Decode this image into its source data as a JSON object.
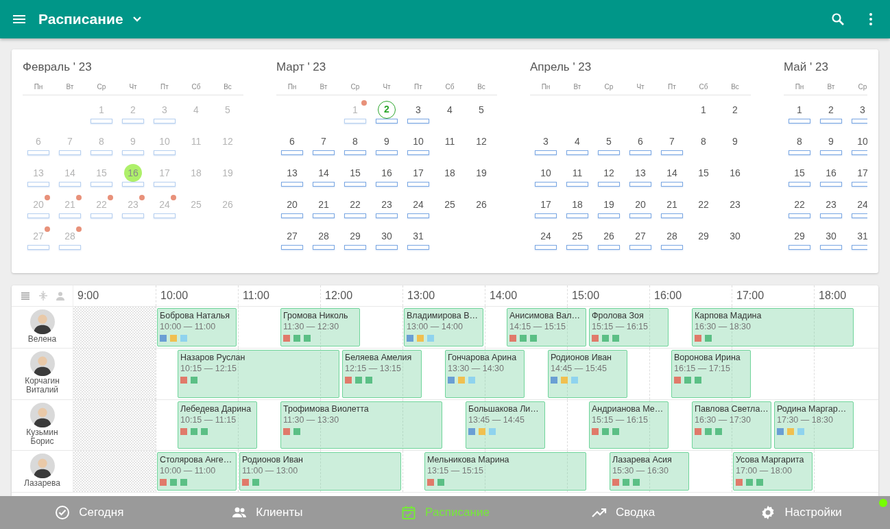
{
  "app_bar": {
    "title": "Расписание"
  },
  "calendar": {
    "months": [
      {
        "title": "Февраль ' 23",
        "weekdays": [
          "Пн",
          "Вт",
          "Ср",
          "Чт",
          "Пт",
          "Сб",
          "Вс"
        ],
        "weeks": [
          [
            {
              "kind": "empty"
            },
            {
              "kind": "empty"
            },
            {
              "kind": "day",
              "d": "1",
              "past": true,
              "bar": true,
              "dot": false,
              "selected": false,
              "today": false
            },
            {
              "kind": "day",
              "d": "2",
              "past": true,
              "bar": true,
              "dot": false,
              "selected": false,
              "today": false
            },
            {
              "kind": "day",
              "d": "3",
              "past": true,
              "bar": true,
              "dot": false,
              "selected": false,
              "today": false
            },
            {
              "kind": "day",
              "d": "4",
              "past": true,
              "bar": false,
              "dot": false,
              "selected": false,
              "today": false
            },
            {
              "kind": "day",
              "d": "5",
              "past": true,
              "bar": false,
              "dot": false,
              "selected": false,
              "today": false
            }
          ],
          [
            {
              "kind": "day",
              "d": "6",
              "past": true,
              "bar": true,
              "dot": false,
              "selected": false,
              "today": false
            },
            {
              "kind": "day",
              "d": "7",
              "past": true,
              "bar": true,
              "dot": false,
              "selected": false,
              "today": false
            },
            {
              "kind": "day",
              "d": "8",
              "past": true,
              "bar": true,
              "dot": false,
              "selected": false,
              "today": false
            },
            {
              "kind": "day",
              "d": "9",
              "past": true,
              "bar": true,
              "dot": false,
              "selected": false,
              "today": false
            },
            {
              "kind": "day",
              "d": "10",
              "past": true,
              "bar": true,
              "dot": false,
              "selected": false,
              "today": false
            },
            {
              "kind": "day",
              "d": "11",
              "past": true,
              "bar": false,
              "dot": false,
              "selected": false,
              "today": false
            },
            {
              "kind": "day",
              "d": "12",
              "past": true,
              "bar": false,
              "dot": false,
              "selected": false,
              "today": false
            }
          ],
          [
            {
              "kind": "day",
              "d": "13",
              "past": true,
              "bar": true,
              "dot": false,
              "selected": false,
              "today": false
            },
            {
              "kind": "day",
              "d": "14",
              "past": true,
              "bar": true,
              "dot": false,
              "selected": false,
              "today": false
            },
            {
              "kind": "day",
              "d": "15",
              "past": true,
              "bar": true,
              "dot": false,
              "selected": false,
              "today": false
            },
            {
              "kind": "day",
              "d": "16",
              "past": true,
              "bar": true,
              "dot": false,
              "selected": true,
              "today": false
            },
            {
              "kind": "day",
              "d": "17",
              "past": true,
              "bar": true,
              "dot": false,
              "selected": false,
              "today": false
            },
            {
              "kind": "day",
              "d": "18",
              "past": true,
              "bar": false,
              "dot": false,
              "selected": false,
              "today": false
            },
            {
              "kind": "day",
              "d": "19",
              "past": true,
              "bar": false,
              "dot": false,
              "selected": false,
              "today": false
            }
          ],
          [
            {
              "kind": "day",
              "d": "20",
              "past": true,
              "bar": true,
              "dot": true,
              "selected": false,
              "today": false
            },
            {
              "kind": "day",
              "d": "21",
              "past": true,
              "bar": true,
              "dot": true,
              "selected": false,
              "today": false
            },
            {
              "kind": "day",
              "d": "22",
              "past": true,
              "bar": true,
              "dot": true,
              "selected": false,
              "today": false
            },
            {
              "kind": "day",
              "d": "23",
              "past": true,
              "bar": true,
              "dot": true,
              "selected": false,
              "today": false
            },
            {
              "kind": "day",
              "d": "24",
              "past": true,
              "bar": true,
              "dot": true,
              "selected": false,
              "today": false
            },
            {
              "kind": "day",
              "d": "25",
              "past": true,
              "bar": false,
              "dot": false,
              "selected": false,
              "today": false
            },
            {
              "kind": "day",
              "d": "26",
              "past": true,
              "bar": false,
              "dot": false,
              "selected": false,
              "today": false
            }
          ],
          [
            {
              "kind": "day",
              "d": "27",
              "past": true,
              "bar": true,
              "dot": true,
              "selected": false,
              "today": false
            },
            {
              "kind": "day",
              "d": "28",
              "past": true,
              "bar": true,
              "dot": true,
              "selected": false,
              "today": false
            }
          ]
        ]
      },
      {
        "title": "Март ' 23",
        "weekdays": [
          "Пн",
          "Вт",
          "Ср",
          "Чт",
          "Пт",
          "Сб",
          "Вс"
        ],
        "weeks": [
          [
            {
              "kind": "empty"
            },
            {
              "kind": "empty"
            },
            {
              "kind": "day",
              "d": "1",
              "past": true,
              "bar": true,
              "dot": true,
              "selected": false,
              "today": false
            },
            {
              "kind": "day",
              "d": "2",
              "past": false,
              "bar": true,
              "dot": false,
              "selected": false,
              "today": true
            },
            {
              "kind": "day",
              "d": "3",
              "past": false,
              "bar": true,
              "dot": false,
              "selected": false,
              "today": false
            },
            {
              "kind": "day",
              "d": "4",
              "past": false,
              "bar": false,
              "dot": false,
              "selected": false,
              "today": false
            },
            {
              "kind": "day",
              "d": "5",
              "past": false,
              "bar": false,
              "dot": false,
              "selected": false,
              "today": false
            }
          ],
          [
            {
              "kind": "day",
              "d": "6",
              "past": false,
              "bar": true,
              "dot": false,
              "selected": false,
              "today": false
            },
            {
              "kind": "day",
              "d": "7",
              "past": false,
              "bar": true,
              "dot": false,
              "selected": false,
              "today": false
            },
            {
              "kind": "day",
              "d": "8",
              "past": false,
              "bar": true,
              "dot": false,
              "selected": false,
              "today": false
            },
            {
              "kind": "day",
              "d": "9",
              "past": false,
              "bar": true,
              "dot": false,
              "selected": false,
              "today": false
            },
            {
              "kind": "day",
              "d": "10",
              "past": false,
              "bar": true,
              "dot": false,
              "selected": false,
              "today": false
            },
            {
              "kind": "day",
              "d": "11",
              "past": false,
              "bar": false,
              "dot": false,
              "selected": false,
              "today": false
            },
            {
              "kind": "day",
              "d": "12",
              "past": false,
              "bar": false,
              "dot": false,
              "selected": false,
              "today": false
            }
          ],
          [
            {
              "kind": "day",
              "d": "13",
              "past": false,
              "bar": true,
              "dot": false,
              "selected": false,
              "today": false
            },
            {
              "kind": "day",
              "d": "14",
              "past": false,
              "bar": true,
              "dot": false,
              "selected": false,
              "today": false
            },
            {
              "kind": "day",
              "d": "15",
              "past": false,
              "bar": true,
              "dot": false,
              "selected": false,
              "today": false
            },
            {
              "kind": "day",
              "d": "16",
              "past": false,
              "bar": true,
              "dot": false,
              "selected": false,
              "today": false
            },
            {
              "kind": "day",
              "d": "17",
              "past": false,
              "bar": true,
              "dot": false,
              "selected": false,
              "today": false
            },
            {
              "kind": "day",
              "d": "18",
              "past": false,
              "bar": false,
              "dot": false,
              "selected": false,
              "today": false
            },
            {
              "kind": "day",
              "d": "19",
              "past": false,
              "bar": false,
              "dot": false,
              "selected": false,
              "today": false
            }
          ],
          [
            {
              "kind": "day",
              "d": "20",
              "past": false,
              "bar": true,
              "dot": false,
              "selected": false,
              "today": false
            },
            {
              "kind": "day",
              "d": "21",
              "past": false,
              "bar": true,
              "dot": false,
              "selected": false,
              "today": false
            },
            {
              "kind": "day",
              "d": "22",
              "past": false,
              "bar": true,
              "dot": false,
              "selected": false,
              "today": false
            },
            {
              "kind": "day",
              "d": "23",
              "past": false,
              "bar": true,
              "dot": false,
              "selected": false,
              "today": false
            },
            {
              "kind": "day",
              "d": "24",
              "past": false,
              "bar": true,
              "dot": false,
              "selected": false,
              "today": false
            },
            {
              "kind": "day",
              "d": "25",
              "past": false,
              "bar": false,
              "dot": false,
              "selected": false,
              "today": false
            },
            {
              "kind": "day",
              "d": "26",
              "past": false,
              "bar": false,
              "dot": false,
              "selected": false,
              "today": false
            }
          ],
          [
            {
              "kind": "day",
              "d": "27",
              "past": false,
              "bar": true,
              "dot": false,
              "selected": false,
              "today": false
            },
            {
              "kind": "day",
              "d": "28",
              "past": false,
              "bar": true,
              "dot": false,
              "selected": false,
              "today": false
            },
            {
              "kind": "day",
              "d": "29",
              "past": false,
              "bar": true,
              "dot": false,
              "selected": false,
              "today": false
            },
            {
              "kind": "day",
              "d": "30",
              "past": false,
              "bar": true,
              "dot": false,
              "selected": false,
              "today": false
            },
            {
              "kind": "day",
              "d": "31",
              "past": false,
              "bar": true,
              "dot": false,
              "selected": false,
              "today": false
            }
          ]
        ]
      },
      {
        "title": "Апрель ' 23",
        "weekdays": [
          "Пн",
          "Вт",
          "Ср",
          "Чт",
          "Пт",
          "Сб",
          "Вс"
        ],
        "weeks": [
          [
            {
              "kind": "empty"
            },
            {
              "kind": "empty"
            },
            {
              "kind": "empty"
            },
            {
              "kind": "empty"
            },
            {
              "kind": "empty"
            },
            {
              "kind": "day",
              "d": "1",
              "past": false,
              "bar": false,
              "dot": false,
              "selected": false,
              "today": false
            },
            {
              "kind": "day",
              "d": "2",
              "past": false,
              "bar": false,
              "dot": false,
              "selected": false,
              "today": false
            }
          ],
          [
            {
              "kind": "day",
              "d": "3",
              "past": false,
              "bar": true,
              "dot": false,
              "selected": false,
              "today": false
            },
            {
              "kind": "day",
              "d": "4",
              "past": false,
              "bar": true,
              "dot": false,
              "selected": false,
              "today": false
            },
            {
              "kind": "day",
              "d": "5",
              "past": false,
              "bar": true,
              "dot": false,
              "selected": false,
              "today": false
            },
            {
              "kind": "day",
              "d": "6",
              "past": false,
              "bar": true,
              "dot": false,
              "selected": false,
              "today": false
            },
            {
              "kind": "day",
              "d": "7",
              "past": false,
              "bar": true,
              "dot": false,
              "selected": false,
              "today": false
            },
            {
              "kind": "day",
              "d": "8",
              "past": false,
              "bar": false,
              "dot": false,
              "selected": false,
              "today": false
            },
            {
              "kind": "day",
              "d": "9",
              "past": false,
              "bar": false,
              "dot": false,
              "selected": false,
              "today": false
            }
          ],
          [
            {
              "kind": "day",
              "d": "10",
              "past": false,
              "bar": true,
              "dot": false,
              "selected": false,
              "today": false
            },
            {
              "kind": "day",
              "d": "11",
              "past": false,
              "bar": true,
              "dot": false,
              "selected": false,
              "today": false
            },
            {
              "kind": "day",
              "d": "12",
              "past": false,
              "bar": true,
              "dot": false,
              "selected": false,
              "today": false
            },
            {
              "kind": "day",
              "d": "13",
              "past": false,
              "bar": true,
              "dot": false,
              "selected": false,
              "today": false
            },
            {
              "kind": "day",
              "d": "14",
              "past": false,
              "bar": true,
              "dot": false,
              "selected": false,
              "today": false
            },
            {
              "kind": "day",
              "d": "15",
              "past": false,
              "bar": false,
              "dot": false,
              "selected": false,
              "today": false
            },
            {
              "kind": "day",
              "d": "16",
              "past": false,
              "bar": false,
              "dot": false,
              "selected": false,
              "today": false
            }
          ],
          [
            {
              "kind": "day",
              "d": "17",
              "past": false,
              "bar": true,
              "dot": false,
              "selected": false,
              "today": false
            },
            {
              "kind": "day",
              "d": "18",
              "past": false,
              "bar": true,
              "dot": false,
              "selected": false,
              "today": false
            },
            {
              "kind": "day",
              "d": "19",
              "past": false,
              "bar": true,
              "dot": false,
              "selected": false,
              "today": false
            },
            {
              "kind": "day",
              "d": "20",
              "past": false,
              "bar": true,
              "dot": false,
              "selected": false,
              "today": false
            },
            {
              "kind": "day",
              "d": "21",
              "past": false,
              "bar": true,
              "dot": false,
              "selected": false,
              "today": false
            },
            {
              "kind": "day",
              "d": "22",
              "past": false,
              "bar": false,
              "dot": false,
              "selected": false,
              "today": false
            },
            {
              "kind": "day",
              "d": "23",
              "past": false,
              "bar": false,
              "dot": false,
              "selected": false,
              "today": false
            }
          ],
          [
            {
              "kind": "day",
              "d": "24",
              "past": false,
              "bar": true,
              "dot": false,
              "selected": false,
              "today": false
            },
            {
              "kind": "day",
              "d": "25",
              "past": false,
              "bar": true,
              "dot": false,
              "selected": false,
              "today": false
            },
            {
              "kind": "day",
              "d": "26",
              "past": false,
              "bar": true,
              "dot": false,
              "selected": false,
              "today": false
            },
            {
              "kind": "day",
              "d": "27",
              "past": false,
              "bar": true,
              "dot": false,
              "selected": false,
              "today": false
            },
            {
              "kind": "day",
              "d": "28",
              "past": false,
              "bar": true,
              "dot": false,
              "selected": false,
              "today": false
            },
            {
              "kind": "day",
              "d": "29",
              "past": false,
              "bar": false,
              "dot": false,
              "selected": false,
              "today": false
            },
            {
              "kind": "day",
              "d": "30",
              "past": false,
              "bar": false,
              "dot": false,
              "selected": false,
              "today": false
            }
          ]
        ]
      },
      {
        "title": "Май ' 23",
        "weekdays": [
          "Пн",
          "Вт",
          "Ср"
        ],
        "weeks": [
          [
            {
              "kind": "day",
              "d": "1",
              "past": false,
              "bar": true,
              "dot": false,
              "selected": false,
              "today": false
            },
            {
              "kind": "day",
              "d": "2",
              "past": false,
              "bar": true,
              "dot": false,
              "selected": false,
              "today": false
            },
            {
              "kind": "day",
              "d": "3",
              "past": false,
              "bar": true,
              "dot": false,
              "selected": false,
              "today": false
            }
          ],
          [
            {
              "kind": "day",
              "d": "8",
              "past": false,
              "bar": true,
              "dot": false,
              "selected": false,
              "today": false
            },
            {
              "kind": "day",
              "d": "9",
              "past": false,
              "bar": true,
              "dot": false,
              "selected": false,
              "today": false
            },
            {
              "kind": "day",
              "d": "10",
              "past": false,
              "bar": true,
              "dot": false,
              "selected": false,
              "today": false
            }
          ],
          [
            {
              "kind": "day",
              "d": "15",
              "past": false,
              "bar": true,
              "dot": false,
              "selected": false,
              "today": false
            },
            {
              "kind": "day",
              "d": "16",
              "past": false,
              "bar": true,
              "dot": false,
              "selected": false,
              "today": false
            },
            {
              "kind": "day",
              "d": "17",
              "past": false,
              "bar": true,
              "dot": false,
              "selected": false,
              "today": false
            }
          ],
          [
            {
              "kind": "day",
              "d": "22",
              "past": false,
              "bar": true,
              "dot": false,
              "selected": false,
              "today": false
            },
            {
              "kind": "day",
              "d": "23",
              "past": false,
              "bar": true,
              "dot": false,
              "selected": false,
              "today": false
            },
            {
              "kind": "day",
              "d": "24",
              "past": false,
              "bar": true,
              "dot": false,
              "selected": false,
              "today": false
            }
          ],
          [
            {
              "kind": "day",
              "d": "29",
              "past": false,
              "bar": true,
              "dot": false,
              "selected": false,
              "today": false
            },
            {
              "kind": "day",
              "d": "30",
              "past": false,
              "bar": true,
              "dot": false,
              "selected": false,
              "today": false
            },
            {
              "kind": "day",
              "d": "31",
              "past": false,
              "bar": true,
              "dot": false,
              "selected": false,
              "today": false
            }
          ]
        ]
      }
    ]
  },
  "schedule": {
    "hours": [
      {
        "label": "9:00",
        "blocked": true
      },
      {
        "label": "10:00",
        "blocked": false
      },
      {
        "label": "11:00",
        "blocked": false
      },
      {
        "label": "12:00",
        "blocked": false
      },
      {
        "label": "13:00",
        "blocked": false
      },
      {
        "label": "14:00",
        "blocked": false
      },
      {
        "label": "15:00",
        "blocked": false
      },
      {
        "label": "16:00",
        "blocked": false
      },
      {
        "label": "17:00",
        "blocked": false
      },
      {
        "label": "18:00",
        "blocked": false
      }
    ],
    "staff": [
      {
        "name": "Велена",
        "appointments": [
          {
            "client": "Боброва Наталья",
            "time": "10:00 — 11:00",
            "tags": [
              {
                "color": "#6a9fd4"
              },
              {
                "color": "#f0c050"
              },
              {
                "color": "#8fd3ee"
              }
            ]
          },
          {
            "client": "Громова Николь",
            "time": "11:30 — 12:30",
            "tags": [
              {
                "color": "#e07a6a"
              },
              {
                "color": "#5bbf85"
              },
              {
                "color": "#5bbf85"
              }
            ]
          },
          {
            "client": "Владимирова В…",
            "time": "13:00 — 14:00",
            "tags": [
              {
                "color": "#6a9fd4"
              },
              {
                "color": "#f0c050"
              },
              {
                "color": "#8fd3ee"
              }
            ]
          },
          {
            "client": "Анисимова Вал…",
            "time": "14:15 — 15:15",
            "tags": [
              {
                "color": "#e07a6a"
              },
              {
                "color": "#5bbf85"
              },
              {
                "color": "#5bbf85"
              }
            ]
          },
          {
            "client": "Фролова Зоя",
            "time": "15:15 — 16:15",
            "tags": [
              {
                "color": "#e07a6a"
              },
              {
                "color": "#5bbf85"
              },
              {
                "color": "#5bbf85"
              }
            ]
          },
          {
            "client": "Карпова Мадина",
            "time": "16:30 — 18:30",
            "tags": [
              {
                "color": "#e07a6a"
              },
              {
                "color": "#5bbf85"
              }
            ]
          }
        ]
      },
      {
        "name": "Корчагин Виталий",
        "appointments": [
          {
            "client": "Назаров Руслан",
            "time": "10:15 — 12:15",
            "tags": [
              {
                "color": "#e07a6a"
              },
              {
                "color": "#5bbf85"
              }
            ]
          },
          {
            "client": "Беляева Амелия",
            "time": "12:15 — 13:15",
            "tags": [
              {
                "color": "#e07a6a"
              },
              {
                "color": "#5bbf85"
              },
              {
                "color": "#5bbf85"
              }
            ]
          },
          {
            "client": "Гончарова Арина",
            "time": "13:30 — 14:30",
            "tags": [
              {
                "color": "#6a9fd4"
              },
              {
                "color": "#f0c050"
              },
              {
                "color": "#8fd3ee"
              }
            ]
          },
          {
            "client": "Родионов Иван",
            "time": "14:45 — 15:45",
            "tags": [
              {
                "color": "#6a9fd4"
              },
              {
                "color": "#f0c050"
              },
              {
                "color": "#8fd3ee"
              }
            ]
          },
          {
            "client": "Воронова Ирина",
            "time": "16:15 — 17:15",
            "tags": [
              {
                "color": "#e07a6a"
              },
              {
                "color": "#5bbf85"
              },
              {
                "color": "#5bbf85"
              }
            ]
          }
        ]
      },
      {
        "name": "Кузьмин Борис",
        "appointments": [
          {
            "client": "Лебедева Дарина",
            "time": "10:15 — 11:15",
            "tags": [
              {
                "color": "#e07a6a"
              },
              {
                "color": "#5bbf85"
              },
              {
                "color": "#5bbf85"
              }
            ]
          },
          {
            "client": "Трофимова Виолетта",
            "time": "11:30 — 13:30",
            "tags": [
              {
                "color": "#e07a6a"
              },
              {
                "color": "#5bbf85"
              }
            ]
          },
          {
            "client": "Большакова Ли…",
            "time": "13:45 — 14:45",
            "tags": [
              {
                "color": "#6a9fd4"
              },
              {
                "color": "#f0c050"
              },
              {
                "color": "#8fd3ee"
              }
            ]
          },
          {
            "client": "Андрианова Ме…",
            "time": "15:15 — 16:15",
            "tags": [
              {
                "color": "#e07a6a"
              },
              {
                "color": "#5bbf85"
              },
              {
                "color": "#5bbf85"
              }
            ]
          },
          {
            "client": "Павлова Светла…",
            "time": "16:30 — 17:30",
            "tags": [
              {
                "color": "#e07a6a"
              },
              {
                "color": "#5bbf85"
              },
              {
                "color": "#5bbf85"
              }
            ]
          },
          {
            "client": "Родина Маргар…",
            "time": "17:30 — 18:30",
            "tags": [
              {
                "color": "#6a9fd4"
              },
              {
                "color": "#f0c050"
              },
              {
                "color": "#8fd3ee"
              }
            ]
          }
        ]
      },
      {
        "name": "Лазарева",
        "appointments": [
          {
            "client": "Столярова Анге…",
            "time": "10:00 — 11:00",
            "tags": [
              {
                "color": "#e07a6a"
              },
              {
                "color": "#5bbf85"
              },
              {
                "color": "#5bbf85"
              }
            ]
          },
          {
            "client": "Родионов Иван",
            "time": "11:00 — 13:00",
            "tags": [
              {
                "color": "#e07a6a"
              },
              {
                "color": "#5bbf85"
              }
            ]
          },
          {
            "client": "Мельникова Марина",
            "time": "13:15 — 15:15",
            "tags": [
              {
                "color": "#e07a6a"
              },
              {
                "color": "#5bbf85"
              }
            ]
          },
          {
            "client": "Лазарева Асия",
            "time": "15:30 — 16:30",
            "tags": [
              {
                "color": "#e07a6a"
              },
              {
                "color": "#5bbf85"
              },
              {
                "color": "#5bbf85"
              }
            ]
          },
          {
            "client": "Усова Маргарита",
            "time": "17:00 — 18:00",
            "tags": [
              {
                "color": "#e07a6a"
              },
              {
                "color": "#5bbf85"
              },
              {
                "color": "#5bbf85"
              }
            ]
          }
        ]
      }
    ]
  },
  "bottom_nav": {
    "online": true,
    "items": [
      {
        "label": "Сегодня",
        "selected": false
      },
      {
        "label": "Клиенты",
        "selected": false
      },
      {
        "label": "Расписание",
        "selected": true
      },
      {
        "label": "Сводка",
        "selected": false
      },
      {
        "label": "Настройки",
        "selected": false
      }
    ]
  }
}
